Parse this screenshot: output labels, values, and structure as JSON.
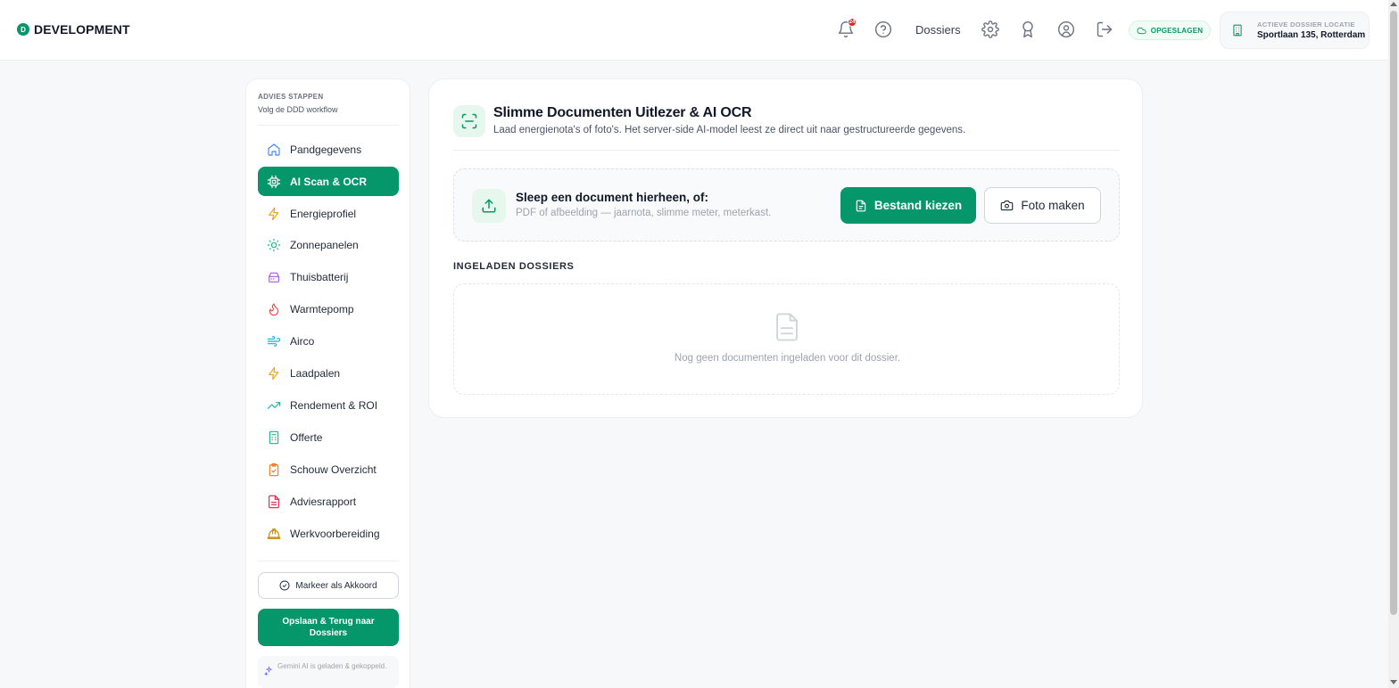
{
  "brand": {
    "badge": "D",
    "name": "DEVELOPMENT"
  },
  "topbar": {
    "notification_count": "24",
    "dossiers_link": "Dossiers",
    "saved_label": "OPGESLAGEN",
    "location_label": "ACTIEVE DOSSIER LOCATIE",
    "location_value": "Sportlaan 135, Rotterdam"
  },
  "sidebar": {
    "title": "ADVIES STAPPEN",
    "subtitle": "Volg de DDD workflow",
    "items": [
      {
        "label": "Pandgegevens",
        "icon": "home-icon",
        "color": "#3b82f6"
      },
      {
        "label": "AI Scan & OCR",
        "icon": "chip-icon",
        "color": "#ffffff",
        "active": true
      },
      {
        "label": "Energieprofiel",
        "icon": "bolt-icon",
        "color": "#f59e0b"
      },
      {
        "label": "Zonnepanelen",
        "icon": "sun-icon",
        "color": "#10b981"
      },
      {
        "label": "Thuisbatterij",
        "icon": "battery-icon",
        "color": "#a855f7"
      },
      {
        "label": "Warmtepomp",
        "icon": "flame-icon",
        "color": "#ef4444"
      },
      {
        "label": "Airco",
        "icon": "wind-icon",
        "color": "#06b6d4"
      },
      {
        "label": "Laadpalen",
        "icon": "bolt-icon",
        "color": "#f59e0b"
      },
      {
        "label": "Rendement & ROI",
        "icon": "trend-up-icon",
        "color": "#14b8a6"
      },
      {
        "label": "Offerte",
        "icon": "calculator-icon",
        "color": "#10b981"
      },
      {
        "label": "Schouw Overzicht",
        "icon": "clipboard-check-icon",
        "color": "#f97316"
      },
      {
        "label": "Adviesrapport",
        "icon": "document-icon",
        "color": "#e11d48"
      },
      {
        "label": "Werkvoorbereiding",
        "icon": "hardhat-icon",
        "color": "#ca8a04"
      }
    ],
    "akkoord_label": "Markeer als Akkoord",
    "save_label": "Opslaan & Terug naar Dossiers",
    "ai_note": "Gemini AI is geladen & gekoppeld."
  },
  "main": {
    "title": "Slimme Documenten Uitlezer & AI OCR",
    "subtitle": "Laad energienota's of foto's. Het server-side AI-model leest ze direct uit naar gestructureerde gegevens.",
    "dropzone_title": "Sleep een document hierheen, of:",
    "dropzone_sub": "PDF of afbeelding — jaarnota, slimme meter, meterkast.",
    "choose_file_label": "Bestand kiezen",
    "take_photo_label": "Foto maken",
    "section_heading": "INGELADEN DOSSIERS",
    "empty_text": "Nog geen documenten ingeladen voor dit dossier."
  },
  "colors": {
    "accent": "#059669",
    "badge": "#dc2626"
  }
}
